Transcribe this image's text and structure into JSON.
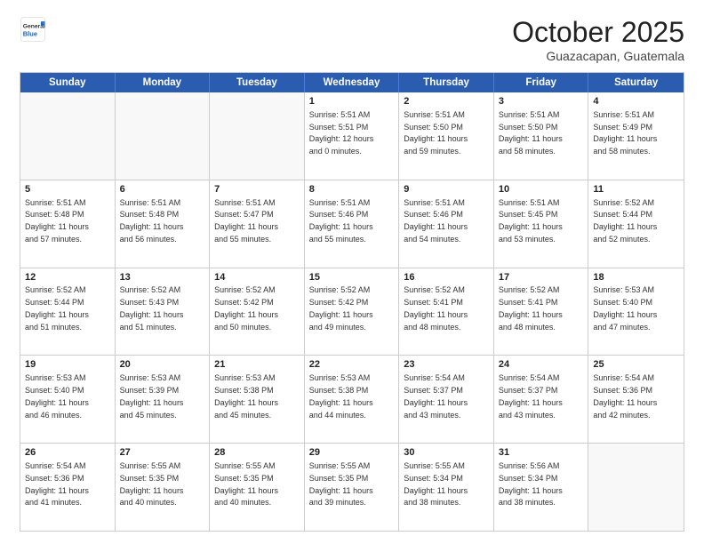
{
  "logo": {
    "general": "General",
    "blue": "Blue"
  },
  "header": {
    "month": "October 2025",
    "location": "Guazacapan, Guatemala"
  },
  "days": [
    "Sunday",
    "Monday",
    "Tuesday",
    "Wednesday",
    "Thursday",
    "Friday",
    "Saturday"
  ],
  "weeks": [
    [
      {
        "num": "",
        "text": ""
      },
      {
        "num": "",
        "text": ""
      },
      {
        "num": "",
        "text": ""
      },
      {
        "num": "1",
        "text": "Sunrise: 5:51 AM\nSunset: 5:51 PM\nDaylight: 12 hours\nand 0 minutes."
      },
      {
        "num": "2",
        "text": "Sunrise: 5:51 AM\nSunset: 5:50 PM\nDaylight: 11 hours\nand 59 minutes."
      },
      {
        "num": "3",
        "text": "Sunrise: 5:51 AM\nSunset: 5:50 PM\nDaylight: 11 hours\nand 58 minutes."
      },
      {
        "num": "4",
        "text": "Sunrise: 5:51 AM\nSunset: 5:49 PM\nDaylight: 11 hours\nand 58 minutes."
      }
    ],
    [
      {
        "num": "5",
        "text": "Sunrise: 5:51 AM\nSunset: 5:48 PM\nDaylight: 11 hours\nand 57 minutes."
      },
      {
        "num": "6",
        "text": "Sunrise: 5:51 AM\nSunset: 5:48 PM\nDaylight: 11 hours\nand 56 minutes."
      },
      {
        "num": "7",
        "text": "Sunrise: 5:51 AM\nSunset: 5:47 PM\nDaylight: 11 hours\nand 55 minutes."
      },
      {
        "num": "8",
        "text": "Sunrise: 5:51 AM\nSunset: 5:46 PM\nDaylight: 11 hours\nand 55 minutes."
      },
      {
        "num": "9",
        "text": "Sunrise: 5:51 AM\nSunset: 5:46 PM\nDaylight: 11 hours\nand 54 minutes."
      },
      {
        "num": "10",
        "text": "Sunrise: 5:51 AM\nSunset: 5:45 PM\nDaylight: 11 hours\nand 53 minutes."
      },
      {
        "num": "11",
        "text": "Sunrise: 5:52 AM\nSunset: 5:44 PM\nDaylight: 11 hours\nand 52 minutes."
      }
    ],
    [
      {
        "num": "12",
        "text": "Sunrise: 5:52 AM\nSunset: 5:44 PM\nDaylight: 11 hours\nand 51 minutes."
      },
      {
        "num": "13",
        "text": "Sunrise: 5:52 AM\nSunset: 5:43 PM\nDaylight: 11 hours\nand 51 minutes."
      },
      {
        "num": "14",
        "text": "Sunrise: 5:52 AM\nSunset: 5:42 PM\nDaylight: 11 hours\nand 50 minutes."
      },
      {
        "num": "15",
        "text": "Sunrise: 5:52 AM\nSunset: 5:42 PM\nDaylight: 11 hours\nand 49 minutes."
      },
      {
        "num": "16",
        "text": "Sunrise: 5:52 AM\nSunset: 5:41 PM\nDaylight: 11 hours\nand 48 minutes."
      },
      {
        "num": "17",
        "text": "Sunrise: 5:52 AM\nSunset: 5:41 PM\nDaylight: 11 hours\nand 48 minutes."
      },
      {
        "num": "18",
        "text": "Sunrise: 5:53 AM\nSunset: 5:40 PM\nDaylight: 11 hours\nand 47 minutes."
      }
    ],
    [
      {
        "num": "19",
        "text": "Sunrise: 5:53 AM\nSunset: 5:40 PM\nDaylight: 11 hours\nand 46 minutes."
      },
      {
        "num": "20",
        "text": "Sunrise: 5:53 AM\nSunset: 5:39 PM\nDaylight: 11 hours\nand 45 minutes."
      },
      {
        "num": "21",
        "text": "Sunrise: 5:53 AM\nSunset: 5:38 PM\nDaylight: 11 hours\nand 45 minutes."
      },
      {
        "num": "22",
        "text": "Sunrise: 5:53 AM\nSunset: 5:38 PM\nDaylight: 11 hours\nand 44 minutes."
      },
      {
        "num": "23",
        "text": "Sunrise: 5:54 AM\nSunset: 5:37 PM\nDaylight: 11 hours\nand 43 minutes."
      },
      {
        "num": "24",
        "text": "Sunrise: 5:54 AM\nSunset: 5:37 PM\nDaylight: 11 hours\nand 43 minutes."
      },
      {
        "num": "25",
        "text": "Sunrise: 5:54 AM\nSunset: 5:36 PM\nDaylight: 11 hours\nand 42 minutes."
      }
    ],
    [
      {
        "num": "26",
        "text": "Sunrise: 5:54 AM\nSunset: 5:36 PM\nDaylight: 11 hours\nand 41 minutes."
      },
      {
        "num": "27",
        "text": "Sunrise: 5:55 AM\nSunset: 5:35 PM\nDaylight: 11 hours\nand 40 minutes."
      },
      {
        "num": "28",
        "text": "Sunrise: 5:55 AM\nSunset: 5:35 PM\nDaylight: 11 hours\nand 40 minutes."
      },
      {
        "num": "29",
        "text": "Sunrise: 5:55 AM\nSunset: 5:35 PM\nDaylight: 11 hours\nand 39 minutes."
      },
      {
        "num": "30",
        "text": "Sunrise: 5:55 AM\nSunset: 5:34 PM\nDaylight: 11 hours\nand 38 minutes."
      },
      {
        "num": "31",
        "text": "Sunrise: 5:56 AM\nSunset: 5:34 PM\nDaylight: 11 hours\nand 38 minutes."
      },
      {
        "num": "",
        "text": ""
      }
    ]
  ]
}
